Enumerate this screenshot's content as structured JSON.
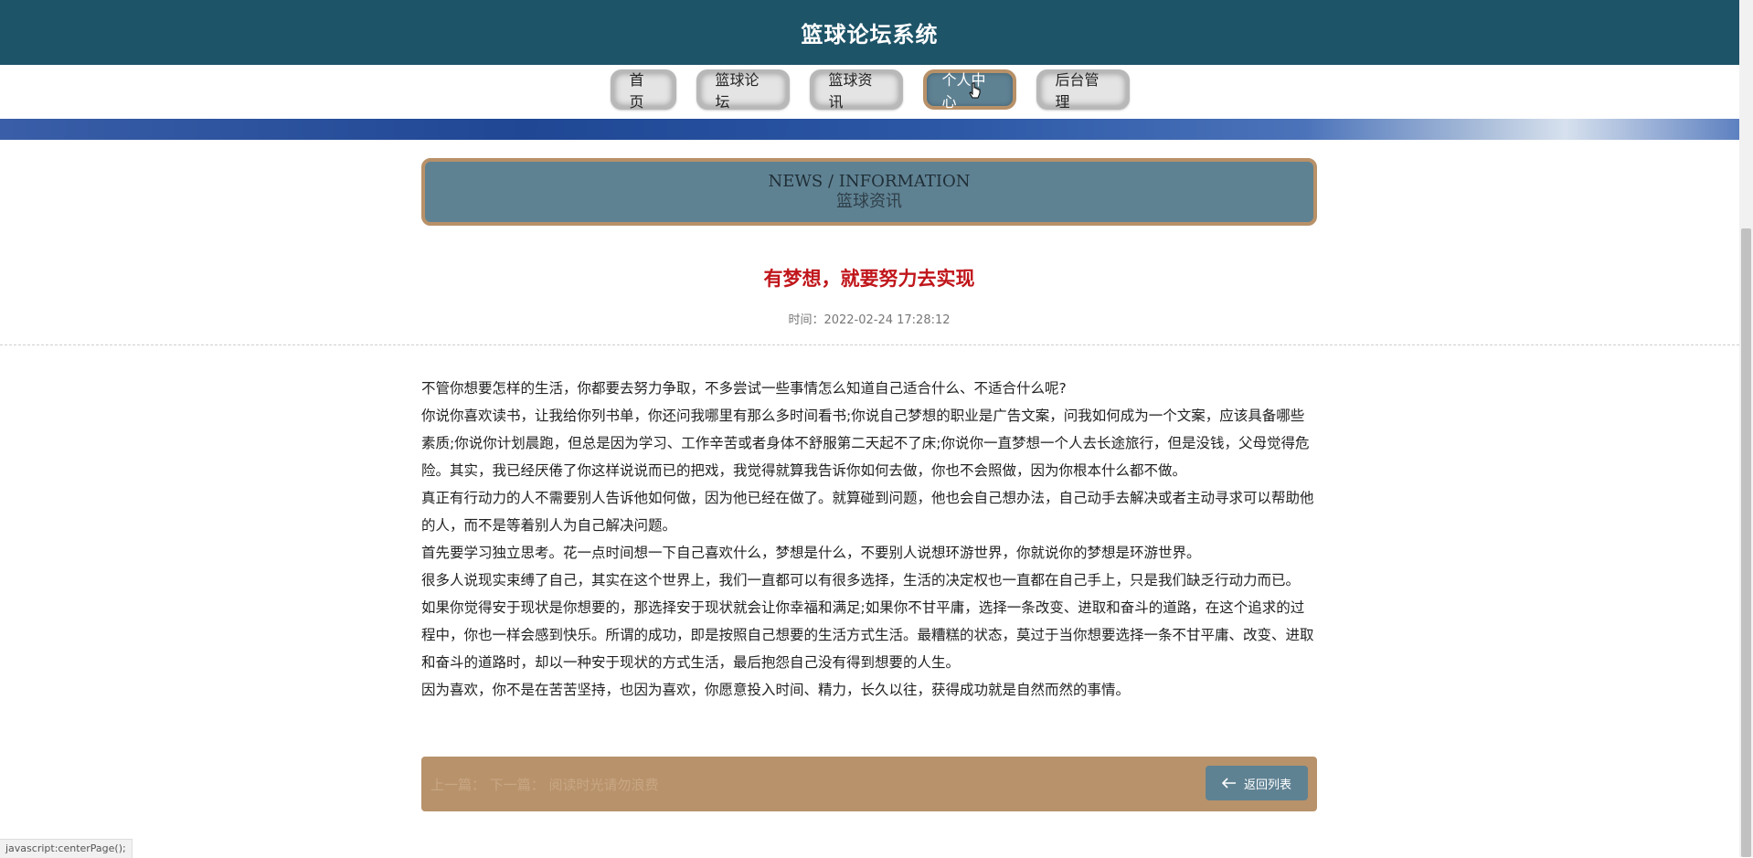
{
  "header": {
    "title": "篮球论坛系统"
  },
  "nav": {
    "items": [
      {
        "label": "首页"
      },
      {
        "label": "篮球论坛"
      },
      {
        "label": "篮球资讯"
      },
      {
        "label": "个人中心"
      },
      {
        "label": "后台管理"
      }
    ],
    "active_index": 3
  },
  "section": {
    "en": "NEWS / INFORMATION",
    "cn": "篮球资讯"
  },
  "article": {
    "title": "有梦想，就要努力去实现",
    "time": "时间：2022-02-24 17:28:12",
    "paragraphs": [
      "不管你想要怎样的生活，你都要去努力争取，不多尝试一些事情怎么知道自己适合什么、不适合什么呢?",
      "你说你喜欢读书，让我给你列书单，你还问我哪里有那么多时间看书;你说自己梦想的职业是广告文案，问我如何成为一个文案，应该具备哪些素质;你说你计划晨跑，但总是因为学习、工作辛苦或者身体不舒服第二天起不了床;你说你一直梦想一个人去长途旅行，但是没钱，父母觉得危险。其实，我已经厌倦了你这样说说而已的把戏，我觉得就算我告诉你如何去做，你也不会照做，因为你根本什么都不做。",
      "真正有行动力的人不需要别人告诉他如何做，因为他已经在做了。就算碰到问题，他也会自己想办法，自己动手去解决或者主动寻求可以帮助他的人，而不是等着别人为自己解决问题。",
      "首先要学习独立思考。花一点时间想一下自己喜欢什么，梦想是什么，不要别人说想环游世界，你就说你的梦想是环游世界。",
      "很多人说现实束缚了自己，其实在这个世界上，我们一直都可以有很多选择，生活的决定权也一直都在自己手上，只是我们缺乏行动力而已。",
      "如果你觉得安于现状是你想要的，那选择安于现状就会让你幸福和满足;如果你不甘平庸，选择一条改变、进取和奋斗的道路，在这个追求的过程中，你也一样会感到快乐。所谓的成功，即是按照自己想要的生活方式生活。最糟糕的状态，莫过于当你想要选择一条不甘平庸、改变、进取和奋斗的道路时，却以一种安于现状的方式生活，最后抱怨自己没有得到想要的人生。",
      "因为喜欢，你不是在苦苦坚持，也因为喜欢，你愿意投入时间、精力，长久以往，获得成功就是自然而然的事情。"
    ]
  },
  "footer": {
    "prev_next": "上一篇：    下一篇：    阅读时光请勿浪费",
    "back_label": "返回列表"
  },
  "status": {
    "text": "javascript:centerPage();"
  },
  "colors": {
    "header_bg": "#1e5468",
    "accent": "#5f8293",
    "accent_border": "#b89168",
    "title_red": "#c0161b"
  }
}
